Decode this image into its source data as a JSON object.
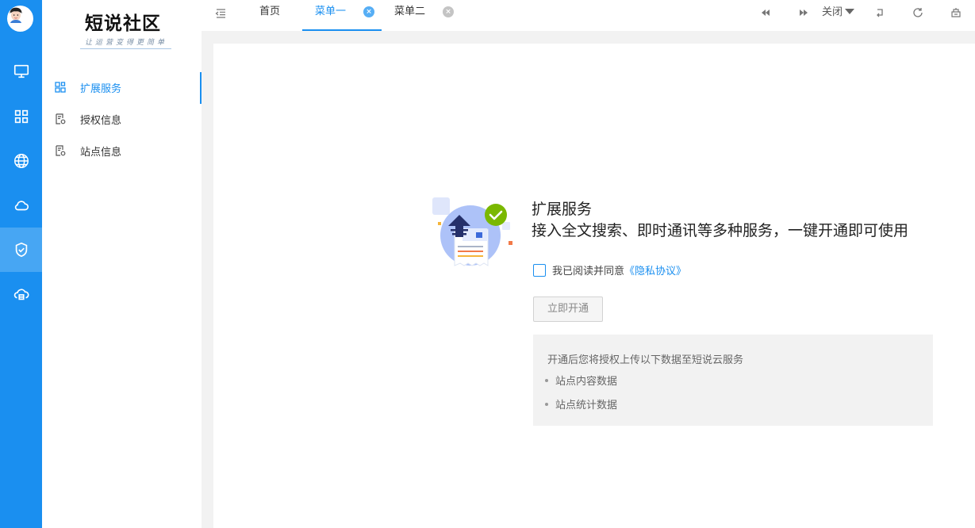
{
  "brand": {
    "title": "短说社区",
    "subtitle": "让运营变得更简单"
  },
  "colors": {
    "primary": "#1a8ff0",
    "rail_active": "#47a6f3",
    "success": "#7ab800"
  },
  "rail": {
    "items": [
      {
        "icon": "monitor-icon"
      },
      {
        "icon": "apps-grid-icon"
      },
      {
        "icon": "globe-icon"
      },
      {
        "icon": "cloud-icon"
      },
      {
        "icon": "shield-check-icon",
        "active": true
      },
      {
        "icon": "cloud-server-icon"
      }
    ]
  },
  "sidebar": {
    "items": [
      {
        "label": "扩展服务",
        "icon": "extension-icon",
        "active": true
      },
      {
        "label": "授权信息",
        "icon": "document-settings-icon"
      },
      {
        "label": "站点信息",
        "icon": "document-settings-icon"
      }
    ]
  },
  "tabs": [
    {
      "label": "首页"
    },
    {
      "label": "菜单一",
      "active": true
    },
    {
      "label": "菜单二"
    }
  ],
  "toolbar": {
    "close_label": "关闭"
  },
  "service": {
    "title": "扩展服务",
    "description": "接入全文搜索、即时通讯等多种服务，一键开通即可使用",
    "agree_text": "我已阅读并同意",
    "agree_link": "《隐私协议》",
    "open_button": "立即开通",
    "info_heading": "开通后您将授权上传以下数据至短说云服务",
    "info_items": [
      "站点内容数据",
      "站点统计数据"
    ]
  }
}
